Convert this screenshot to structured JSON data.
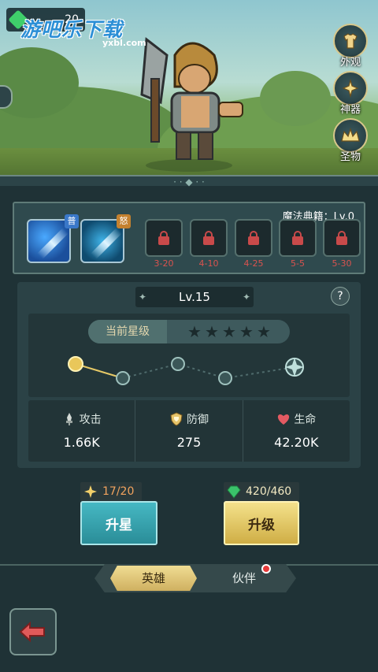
{
  "top_badge": {
    "value": "20"
  },
  "watermark": {
    "text": "游吧乐下载",
    "sub": "yxbl.com"
  },
  "side_menu": {
    "items": [
      {
        "label": "外观",
        "icon": "costume-icon"
      },
      {
        "label": "神器",
        "icon": "artifact-icon"
      },
      {
        "label": "圣物",
        "icon": "relic-icon"
      }
    ]
  },
  "skills": {
    "skill1": {
      "tag": "普",
      "icon": "sword-slash-icon"
    },
    "skill2": {
      "tag": "怒",
      "icon": "blade-icon"
    },
    "book_label": "魔法典籍：Lv.0",
    "locked_slots": [
      "3-20",
      "4-10",
      "4-25",
      "5-5",
      "5-30"
    ]
  },
  "level": {
    "label": "Lv.15"
  },
  "star_rank": {
    "label": "当前星级",
    "stars_total": 5,
    "stars_filled": 0
  },
  "stats": [
    {
      "label": "攻击",
      "value": "1.66K",
      "icon": "attack-icon"
    },
    {
      "label": "防御",
      "value": "275",
      "icon": "shield-icon"
    },
    {
      "label": "生命",
      "value": "42.20K",
      "icon": "heart-icon"
    }
  ],
  "costs": {
    "star_cost": "17/20",
    "gem_cost": "420/460"
  },
  "buttons": {
    "star_up": "升星",
    "level_up": "升级"
  },
  "tabs": {
    "hero": "英雄",
    "partner": "伙伴"
  },
  "colors": {
    "panel_bg": "#1f3236",
    "accent_gold": "#cfae45",
    "accent_teal": "#2a8d98",
    "lock_red": "#d9534f"
  }
}
